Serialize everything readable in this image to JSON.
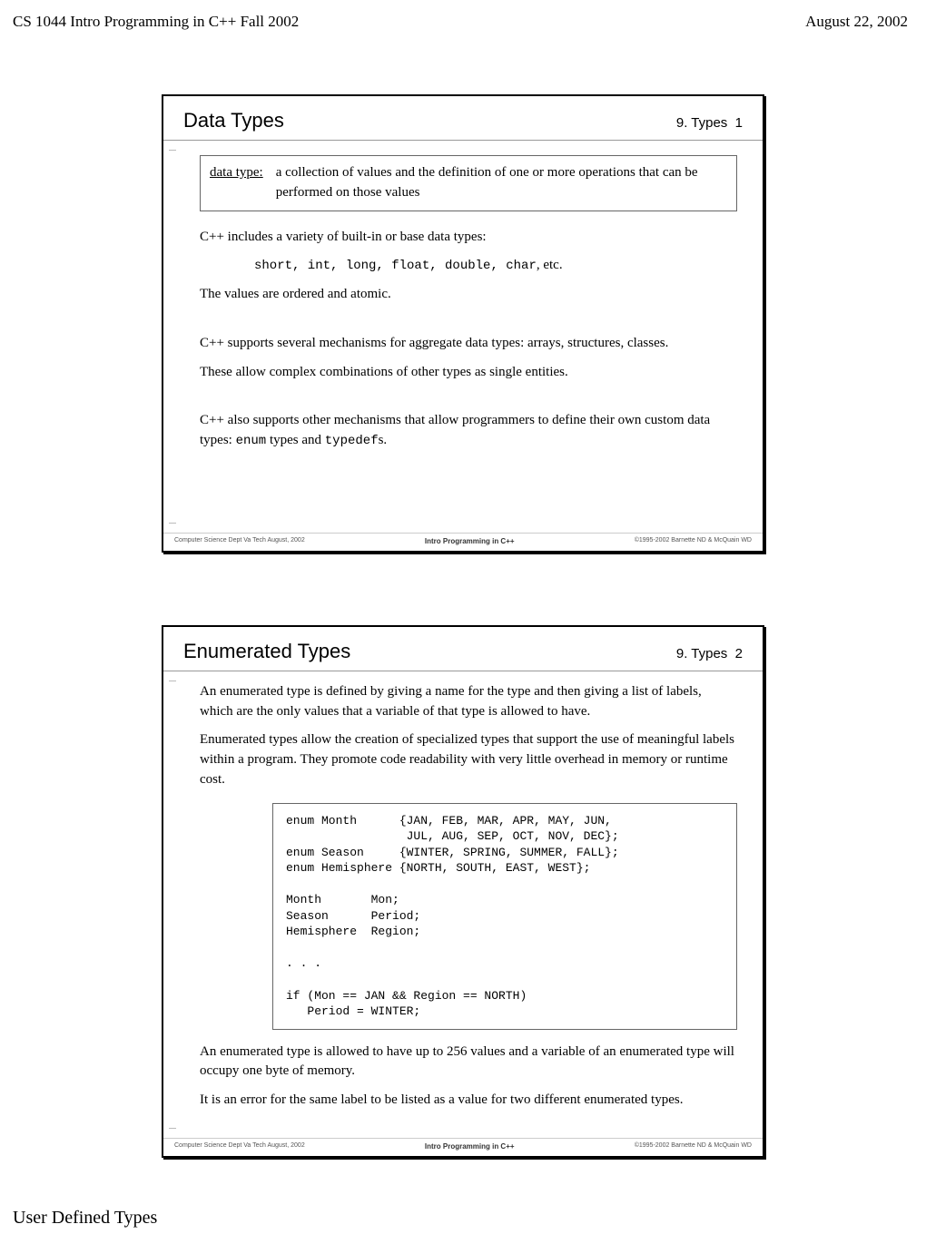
{
  "header": {
    "left": "CS 1044 Intro Programming in C++ Fall 2002",
    "right": "August 22, 2002"
  },
  "slide1": {
    "title": "Data Types",
    "section": "9. Types",
    "num": "1",
    "def_term": "data type:",
    "def_text": "a collection of values and the definition of one or more operations that can be performed on those values",
    "p1": "C++ includes a variety of built-in or base data types:",
    "p1_code_prefix": "short, int, long, float, double, char",
    "p1_code_suffix": ", etc.",
    "p2": "The values are ordered and atomic.",
    "p3": "C++ supports several mechanisms for aggregate data types:  arrays, structures, classes.",
    "p4": "These allow complex combinations of other types as single entities.",
    "p5a": "C++ also supports other mechanisms that allow programmers to define their own custom data types:  ",
    "p5b": "enum",
    "p5c": " types and ",
    "p5d": "typedef",
    "p5e": "s.",
    "foot_left": "Computer Science Dept Va Tech  August, 2002",
    "foot_mid": "Intro Programming in C++",
    "foot_right": "©1995-2002  Barnette ND & McQuain WD"
  },
  "slide2": {
    "title": "Enumerated Types",
    "section": "9. Types",
    "num": "2",
    "p1": "An enumerated type is defined by giving a name for the type and then giving a list of labels, which are the only values that a variable of that type is allowed to have.",
    "p2": "Enumerated types allow the creation of specialized types that support the use of meaningful labels within a program.  They promote code readability with very little overhead in memory or runtime cost.",
    "code": "enum Month      {JAN, FEB, MAR, APR, MAY, JUN,\n                 JUL, AUG, SEP, OCT, NOV, DEC};\nenum Season     {WINTER, SPRING, SUMMER, FALL};\nenum Hemisphere {NORTH, SOUTH, EAST, WEST};\n\nMonth       Mon;\nSeason      Period;\nHemisphere  Region;\n\n. . .\n\nif (Mon == JAN && Region == NORTH)\n   Period = WINTER;",
    "p3": "An enumerated type is allowed to have up to 256 values and a variable of an enumerated type will occupy one byte of memory.",
    "p4": "It is an error for the same label to be listed as a value for two different enumerated types.",
    "foot_left": "Computer Science Dept Va Tech  August, 2002",
    "foot_mid": "Intro Programming in C++",
    "foot_right": "©1995-2002  Barnette ND & McQuain WD"
  },
  "footer": {
    "text": "User Defined Types"
  }
}
